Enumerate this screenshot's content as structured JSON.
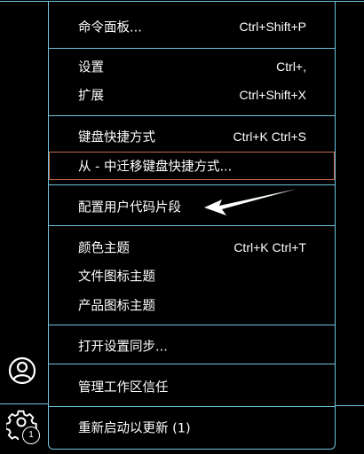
{
  "activity_bar": {
    "badge_count": "1",
    "icons": [
      "account-icon",
      "manage-gear-icon"
    ]
  },
  "menu": {
    "items": [
      {
        "label": "命令面板...",
        "kb": "Ctrl+Shift+P"
      },
      {
        "label": "设置",
        "kb": "Ctrl+,"
      },
      {
        "label": "扩展",
        "kb": "Ctrl+Shift+X"
      },
      {
        "label": "键盘快捷方式",
        "kb": "Ctrl+K Ctrl+S"
      },
      {
        "label": "从 - 中迁移键盘快捷方式...",
        "kb": ""
      },
      {
        "label": "配置用户代码片段",
        "kb": ""
      },
      {
        "label": "颜色主题",
        "kb": "Ctrl+K Ctrl+T"
      },
      {
        "label": "文件图标主题",
        "kb": ""
      },
      {
        "label": "产品图标主题",
        "kb": ""
      },
      {
        "label": "打开设置同步...",
        "kb": ""
      },
      {
        "label": "管理工作区信任",
        "kb": ""
      },
      {
        "label": "重新启动以更新 (1)",
        "kb": ""
      }
    ]
  },
  "colors": {
    "background": "#000000",
    "border": "#6fc3df",
    "focus_outline": "#c26a4a",
    "text": "#ffffff"
  }
}
